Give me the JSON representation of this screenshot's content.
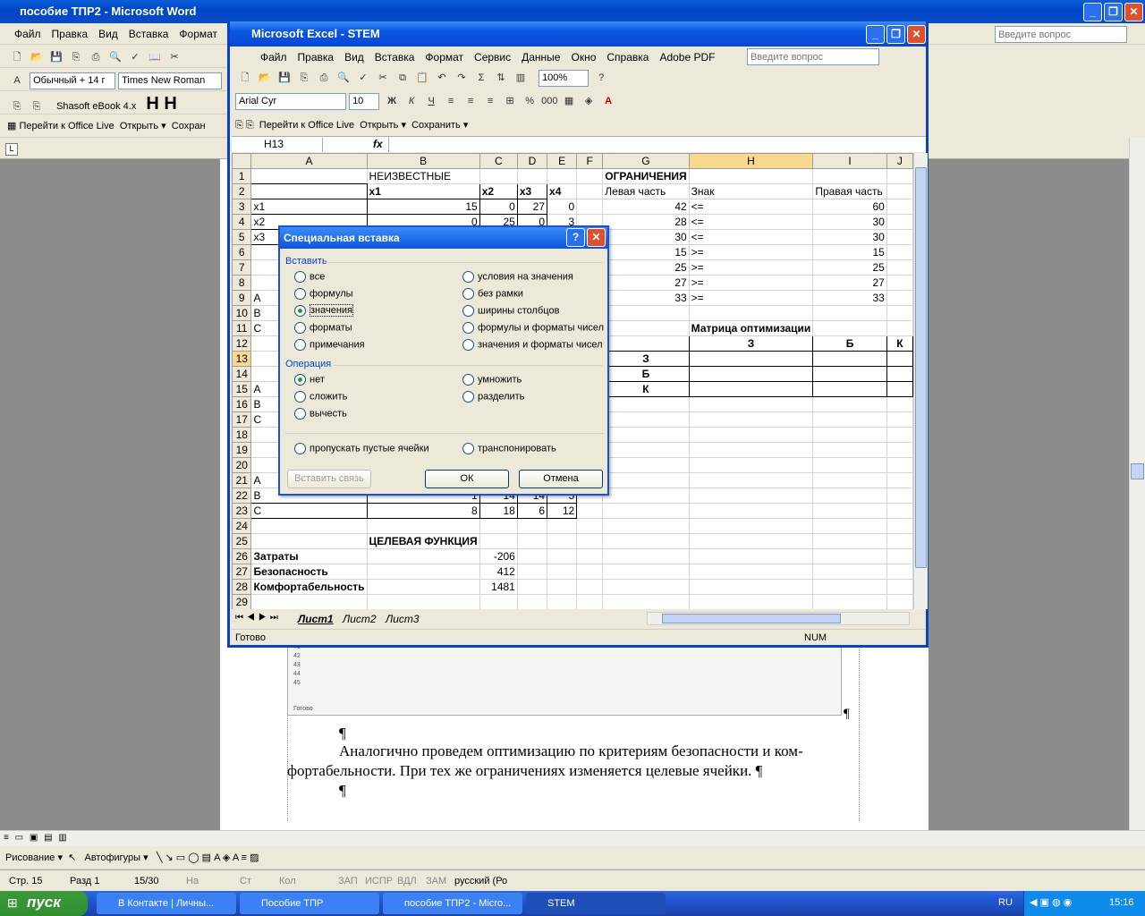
{
  "word": {
    "title": "пособие ТПР2 - Microsoft Word",
    "menu": [
      "Файл",
      "Правка",
      "Вид",
      "Вставка",
      "Формат"
    ],
    "style": "Обычный + 14 г",
    "font": "Times New Roman",
    "addin": "Shasoft eBook 4.x",
    "office_live": "Перейти к Office Live",
    "open": "Открыть",
    "save": "Сохран",
    "help_placeholder": "Введите вопрос",
    "para1": "Аналогично проведем оптимизацию по критериям безопасности и ком-",
    "para2": "фортабельности. При тех же ограничениях изменяется целевые ячейки. ¶",
    "pilcrow": "¶",
    "draw": "Рисование",
    "autoshapes": "Автофигуры",
    "status": {
      "page": "Стр. 15",
      "section": "Разд 1",
      "pages": "15/30",
      "at": "На",
      "ln": "Ст",
      "col": "Кол",
      "rec": "ЗАП",
      "trk": "ИСПР",
      "ext": "ВДЛ",
      "ovr": "ЗАМ",
      "lang": "русский (Ро"
    }
  },
  "excel": {
    "title": "Microsoft Excel - STEM",
    "menu": [
      "Файл",
      "Правка",
      "Вид",
      "Вставка",
      "Формат",
      "Сервис",
      "Данные",
      "Окно",
      "Справка",
      "Adobe PDF"
    ],
    "help_placeholder": "Введите вопрос",
    "zoom": "100%",
    "font": "Arial Cyr",
    "size": "10",
    "office_live": "Перейти к Office Live",
    "open": "Открыть",
    "save": "Сохранить",
    "namebox": "H13",
    "fx": "fx",
    "cols": [
      "A",
      "B",
      "C",
      "D",
      "E",
      "F",
      "G",
      "H",
      "I",
      "J"
    ],
    "rows": [
      [
        "1",
        "",
        "НЕИЗВЕСТНЫЕ",
        "",
        "",
        "",
        "",
        "ОГРАНИЧЕНИЯ",
        "",
        "",
        ""
      ],
      [
        "2",
        "",
        "x1",
        "x2",
        "x3",
        "x4",
        "",
        "Левая часть",
        "Знак",
        "Правая часть",
        ""
      ],
      [
        "3",
        "x1",
        "15",
        "0",
        "27",
        "0",
        "",
        "42",
        "<=",
        "60",
        ""
      ],
      [
        "4",
        "x2",
        "0",
        "25",
        "0",
        "3",
        "",
        "28",
        "<=",
        "30",
        ""
      ],
      [
        "5",
        "x3",
        "",
        "",
        "",
        "",
        "",
        "30",
        "<=",
        "30",
        ""
      ],
      [
        "6",
        "",
        "",
        "",
        "",
        "",
        "",
        "15",
        ">=",
        "15",
        ""
      ],
      [
        "7",
        "",
        "",
        "",
        "",
        "",
        "",
        "25",
        ">=",
        "25",
        ""
      ],
      [
        "8",
        "",
        "",
        "",
        "",
        "",
        "",
        "27",
        ">=",
        "27",
        ""
      ],
      [
        "9",
        "A",
        "",
        "",
        "",
        "",
        "",
        "33",
        ">=",
        "33",
        ""
      ],
      [
        "10",
        "B",
        "",
        "",
        "",
        "",
        "",
        "",
        "",
        "",
        ""
      ],
      [
        "11",
        "C",
        "",
        "",
        "",
        "",
        "",
        "",
        "Матрица оптимизации",
        "",
        ""
      ],
      [
        "12",
        "",
        "",
        "",
        "",
        "",
        "",
        "",
        "З",
        "Б",
        "К"
      ],
      [
        "13",
        "",
        "",
        "",
        "",
        "",
        "",
        "З",
        "",
        "",
        ""
      ],
      [
        "14",
        "",
        "",
        "",
        "",
        "",
        "",
        "Б",
        "",
        "",
        ""
      ],
      [
        "15",
        "A",
        "",
        "",
        "",
        "",
        "",
        "К",
        "",
        "",
        ""
      ],
      [
        "16",
        "B",
        "",
        "",
        "",
        "",
        "",
        "",
        "",
        "",
        ""
      ],
      [
        "17",
        "C",
        "",
        "",
        "",
        "",
        "",
        "",
        "",
        "",
        ""
      ],
      [
        "18",
        "",
        "",
        "",
        "",
        "",
        "",
        "",
        "",
        "",
        ""
      ],
      [
        "19",
        "",
        "",
        "",
        "",
        "",
        "",
        "",
        "",
        "",
        ""
      ],
      [
        "20",
        "",
        "",
        "",
        "",
        "",
        "",
        "",
        "",
        "",
        ""
      ],
      [
        "21",
        "A",
        "",
        "",
        "",
        "",
        "",
        "",
        "",
        "",
        ""
      ],
      [
        "22",
        "B",
        "1",
        "14",
        "14",
        "5",
        "",
        "",
        "",
        "",
        ""
      ],
      [
        "23",
        "C",
        "8",
        "18",
        "6",
        "12",
        "",
        "",
        "",
        "",
        ""
      ],
      [
        "24",
        "",
        "",
        "",
        "",
        "",
        "",
        "",
        "",
        "",
        ""
      ],
      [
        "25",
        "",
        "ЦЕЛЕВАЯ ФУНКЦИЯ",
        "",
        "",
        "",
        "",
        "",
        "",
        "",
        ""
      ],
      [
        "26",
        "Затраты",
        "",
        "-206",
        "",
        "",
        "",
        "",
        "",
        "",
        ""
      ],
      [
        "27",
        "Безопасность",
        "",
        "412",
        "",
        "",
        "",
        "",
        "",
        "",
        ""
      ],
      [
        "28",
        "Комфортабельность",
        "",
        "1481",
        "",
        "",
        "",
        "",
        "",
        "",
        ""
      ],
      [
        "29",
        "",
        "",
        "",
        "",
        "",
        "",
        "",
        "",
        "",
        ""
      ]
    ],
    "sheets": [
      "Лист1",
      "Лист2",
      "Лист3"
    ],
    "status": "Готово",
    "num": "NUM"
  },
  "dialog": {
    "title": "Специальная вставка",
    "group_paste": "Вставить",
    "paste_opts": [
      "все",
      "формулы",
      "значения",
      "форматы",
      "примечания",
      "условия на значения",
      "без рамки",
      "ширины столбцов",
      "формулы и форматы чисел",
      "значения и форматы чисел"
    ],
    "group_op": "Операция",
    "op_opts": [
      "нет",
      "сложить",
      "вычесть",
      "умножить",
      "разделить"
    ],
    "skip_blanks": "пропускать пустые ячейки",
    "transpose": "транспонировать",
    "paste_link": "Вставить связь",
    "ok": "ОК",
    "cancel": "Отмена"
  },
  "taskbar": {
    "start": "пуск",
    "tasks": [
      "В Контакте | Личны...",
      "Пособие ТПР",
      "пособие ТПР2 - Micro...",
      "STEM"
    ],
    "lang": "RU",
    "time": "15:16"
  }
}
